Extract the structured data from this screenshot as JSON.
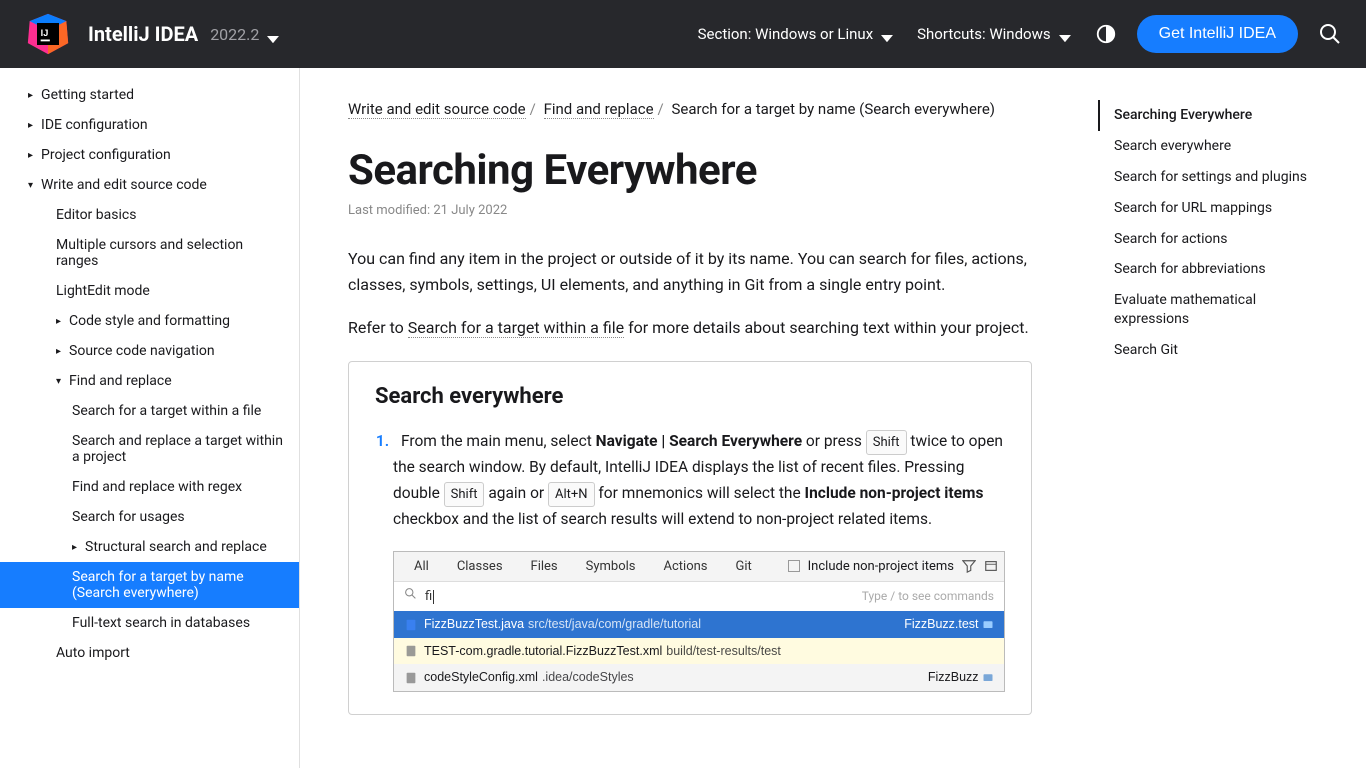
{
  "header": {
    "product_name": "IntelliJ IDEA",
    "version": "2022.2",
    "section_label": "Section: Windows or Linux",
    "shortcuts_label": "Shortcuts: Windows",
    "cta_label": "Get IntelliJ IDEA"
  },
  "sidebar": {
    "items": [
      {
        "label": "Getting started",
        "state": "collapsed",
        "level": 1
      },
      {
        "label": "IDE configuration",
        "state": "collapsed",
        "level": 1
      },
      {
        "label": "Project configuration",
        "state": "collapsed",
        "level": 1
      },
      {
        "label": "Write and edit source code",
        "state": "expanded",
        "level": 1
      },
      {
        "label": "Editor basics",
        "state": "noicon",
        "level": 2
      },
      {
        "label": "Multiple cursors and selection ranges",
        "state": "noicon",
        "level": 2
      },
      {
        "label": "LightEdit mode",
        "state": "noicon",
        "level": 2
      },
      {
        "label": "Code style and formatting",
        "state": "collapsed",
        "level": 2
      },
      {
        "label": "Source code navigation",
        "state": "collapsed",
        "level": 2
      },
      {
        "label": "Find and replace",
        "state": "expanded",
        "level": 2
      },
      {
        "label": "Search for a target within a file",
        "state": "noicon",
        "level": 3
      },
      {
        "label": "Search and replace a target within a project",
        "state": "noicon",
        "level": 3
      },
      {
        "label": "Find and replace with regex",
        "state": "noicon",
        "level": 3
      },
      {
        "label": "Search for usages",
        "state": "noicon",
        "level": 3
      },
      {
        "label": "Structural search and replace",
        "state": "collapsed",
        "level": 3
      },
      {
        "label": "Search for a target by name (Search everywhere)",
        "state": "noicon",
        "level": 3,
        "active": true
      },
      {
        "label": "Full-text search in databases",
        "state": "noicon",
        "level": 3
      },
      {
        "label": "Auto import",
        "state": "noicon",
        "level": 2
      }
    ]
  },
  "breadcrumbs": {
    "items": [
      "Write and edit source code",
      "Find and replace"
    ],
    "current": "Search for a target by name (Search everywhere)"
  },
  "page": {
    "title": "Searching Everywhere",
    "last_modified": "Last modified: 21 July 2022",
    "intro1": "You can find any item in the project or outside of it by its name. You can search for files, actions, classes, symbols, settings, UI elements, and anything in Git from a single entry point.",
    "intro2_prefix": "Refer to ",
    "intro2_link": "Search for a target within a file",
    "intro2_suffix": " for more details about searching text within your project."
  },
  "section": {
    "heading": "Search everywhere",
    "step1": {
      "t1": "From the main menu, select ",
      "menu": "Navigate | Search Everywhere",
      "t2": " or press ",
      "key1": "Shift",
      "t3": " twice to open the search window. By default, IntelliJ IDEA displays the list of recent files. Pressing double ",
      "key2": "Shift",
      "t4": " again or ",
      "key3": "Alt+N",
      "t5": " for mnemonics will select the ",
      "bold2": "Include non-project items",
      "t6": " checkbox and the list of search results will extend to non-project related items."
    },
    "mock": {
      "tabs": [
        "All",
        "Classes",
        "Files",
        "Symbols",
        "Actions",
        "Git"
      ],
      "include_label": "Include non-project items",
      "query": "fi",
      "hint": "Type / to see commands",
      "rows": [
        {
          "file": "FizzBuzzTest.java",
          "path": "src/test/java/com/gradle/tutorial",
          "module": "FizzBuzz.test",
          "sel": true,
          "icon": "class"
        },
        {
          "file": "TEST-com.gradle.tutorial.FizzBuzzTest.xml",
          "path": "build/test-results/test",
          "module": "",
          "hl": true,
          "icon": "file"
        },
        {
          "file": "codeStyleConfig.xml",
          "path": ".idea/codeStyles",
          "module": "FizzBuzz",
          "icon": "file"
        }
      ]
    }
  },
  "toc": {
    "items": [
      "Searching Everywhere",
      "Search everywhere",
      "Search for settings and plugins",
      "Search for URL mappings",
      "Search for actions",
      "Search for abbreviations",
      "Evaluate mathematical expressions",
      "Search Git"
    ]
  }
}
